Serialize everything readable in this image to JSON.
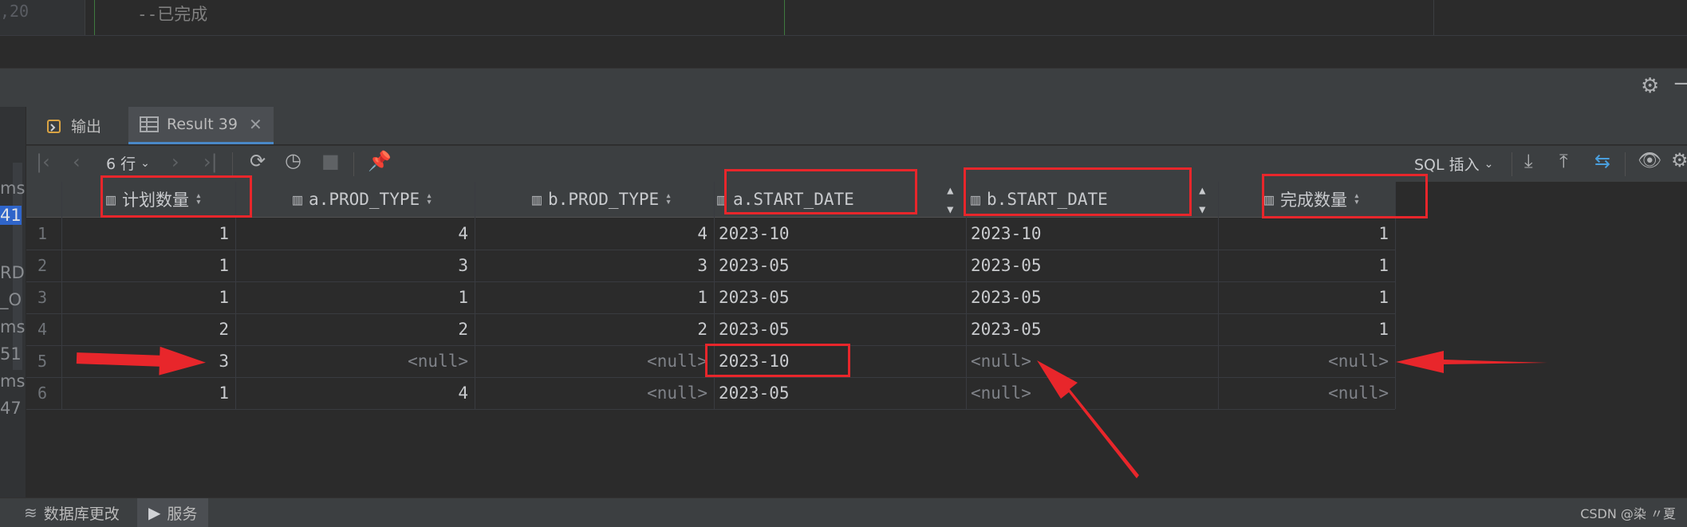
{
  "editor": {
    "line_number": "20",
    "partial_line_mark": ",",
    "code_comment": "--已完成"
  },
  "left_strip": {
    "fragments": [
      "ms",
      "41",
      "RD",
      "_O",
      "ms",
      "51",
      "ms",
      "47"
    ]
  },
  "header": {
    "settings_icon": "gear-icon",
    "minimize_icon": "minus-icon"
  },
  "tabs": [
    {
      "label": "输出",
      "icon": "output-icon"
    },
    {
      "label": "Result 39",
      "icon": "table-icon",
      "active": true
    }
  ],
  "toolbar": {
    "row_count_label": "6 行",
    "submit_mode_label": "SQL 插入"
  },
  "grid": {
    "columns": [
      "计划数量",
      "a.PROD_TYPE",
      "b.PROD_TYPE",
      "a.START_DATE",
      "b.START_DATE",
      "完成数量"
    ],
    "rows": [
      [
        "1",
        "1",
        "4",
        "4",
        "2023-10",
        "2023-10",
        "1"
      ],
      [
        "2",
        "1",
        "3",
        "3",
        "2023-05",
        "2023-05",
        "1"
      ],
      [
        "3",
        "1",
        "1",
        "1",
        "2023-05",
        "2023-05",
        "1"
      ],
      [
        "4",
        "2",
        "2",
        "2",
        "2023-05",
        "2023-05",
        "1"
      ],
      [
        "5",
        "3",
        "<null>",
        "<null>",
        "2023-10",
        "<null>",
        "<null>"
      ],
      [
        "6",
        "1",
        "4",
        "<null>",
        "2023-05",
        "<null>",
        "<null>"
      ]
    ]
  },
  "statusbar": {
    "db_changes_label": "数据库更改",
    "services_label": "服务",
    "watermark": "CSDN @染 〃夏"
  },
  "colors": {
    "annotation_red": "#e8262b",
    "accent_blue": "#4a88c7",
    "background": "#2b2b2b",
    "panel": "#3c3f41"
  }
}
